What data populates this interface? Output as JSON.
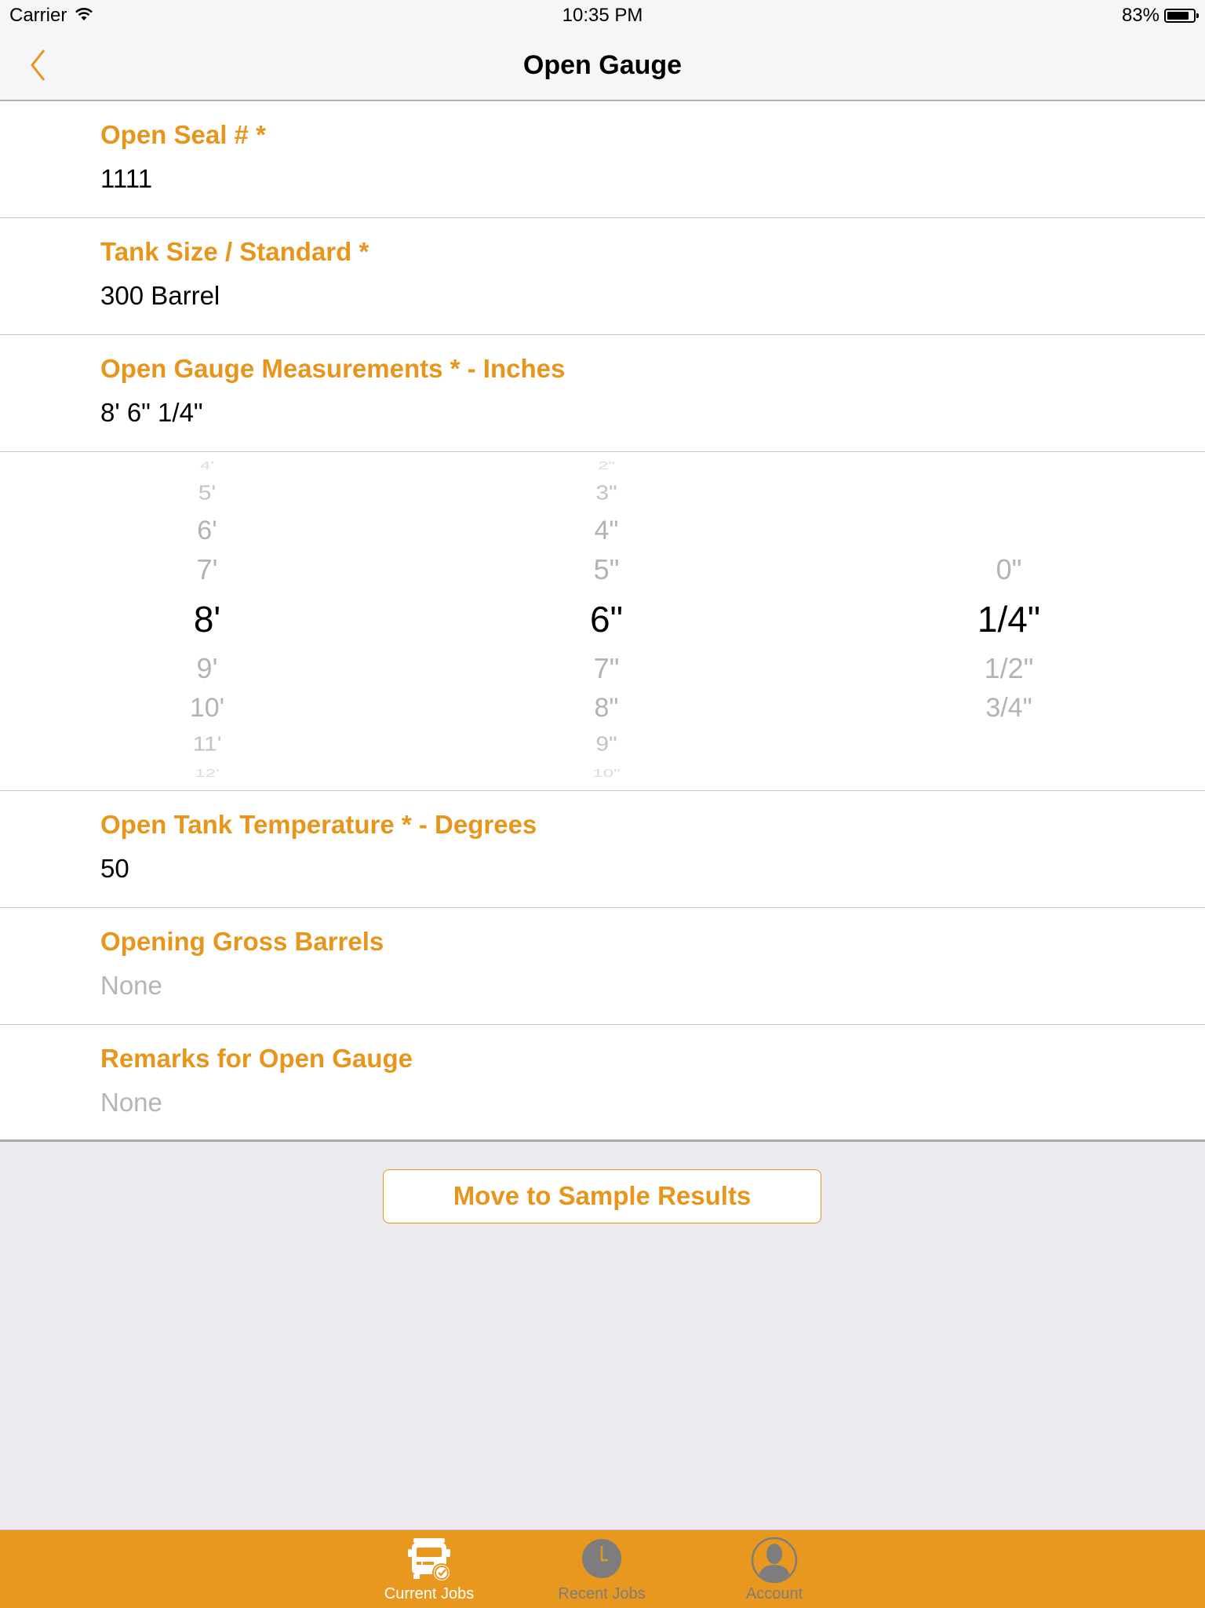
{
  "status_bar": {
    "carrier": "Carrier",
    "time": "10:35 PM",
    "battery_percent_label": "83%",
    "battery_level": 0.83
  },
  "nav": {
    "title": "Open Gauge",
    "back_icon": "chevron-left-icon"
  },
  "fields": [
    {
      "label": "Open Seal # *",
      "value": "1111",
      "is_placeholder": false
    },
    {
      "label": "Tank Size / Standard *",
      "value": "300 Barrel",
      "is_placeholder": false
    },
    {
      "label": "Open Gauge Measurements * - Inches",
      "value": "8' 6\" 1/4\"",
      "is_placeholder": false
    },
    {
      "label": "Open Tank Temperature * - Degrees",
      "value": "50",
      "is_placeholder": false
    },
    {
      "label": "Opening Gross Barrels",
      "value": "None",
      "is_placeholder": true
    },
    {
      "label": "Remarks for Open Gauge",
      "value": "None",
      "is_placeholder": true
    }
  ],
  "picker": {
    "feet": {
      "items": [
        "4'",
        "5'",
        "6'",
        "7'",
        "8'",
        "9'",
        "10'",
        "11'",
        "12'"
      ],
      "selected": "8'"
    },
    "inches": {
      "items": [
        "2\"",
        "3\"",
        "4\"",
        "5\"",
        "6\"",
        "7\"",
        "8\"",
        "9\"",
        "10\""
      ],
      "selected": "6\""
    },
    "fractions": {
      "items": [
        "0\"",
        "1/4\"",
        "1/2\"",
        "3/4\""
      ],
      "selected": "1/4\""
    }
  },
  "action_button": {
    "label": "Move to Sample Results"
  },
  "tab_bar": {
    "tabs": [
      {
        "label": "Current Jobs",
        "icon": "truck-check-icon",
        "active": true
      },
      {
        "label": "Recent Jobs",
        "icon": "clock-icon",
        "active": false
      },
      {
        "label": "Account",
        "icon": "user-silhouette-icon",
        "active": false
      }
    ]
  },
  "colors": {
    "accent": "#e8951c",
    "tab_bar_bg": "#e8971f",
    "inactive_tab": "#7d7d7d",
    "placeholder": "#b4b4b9",
    "background": "#ebebf0"
  }
}
